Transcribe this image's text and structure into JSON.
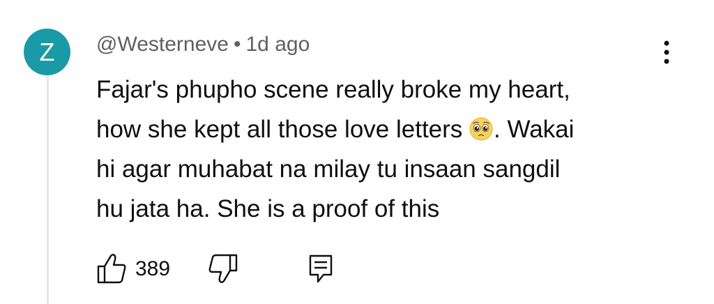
{
  "comment": {
    "avatar_letter": "Z",
    "avatar_color": "#1a9aa6",
    "author": "@Westerneve",
    "separator": "•",
    "time": "1d ago",
    "text_lines": [
      "Fajar's phupho scene really broke my heart,",
      "how she kept all those love letters",
      ". Wakai",
      "hi agar muhabat na milay tu insaan sangdil",
      "hu jata ha. She is a proof of this"
    ],
    "emoji": "pleading-face-emoji",
    "likes": "389"
  },
  "icons": {
    "more": "more-vertical-icon",
    "like": "thumbs-up-icon",
    "dislike": "thumbs-down-icon",
    "reply": "reply-comment-icon"
  }
}
